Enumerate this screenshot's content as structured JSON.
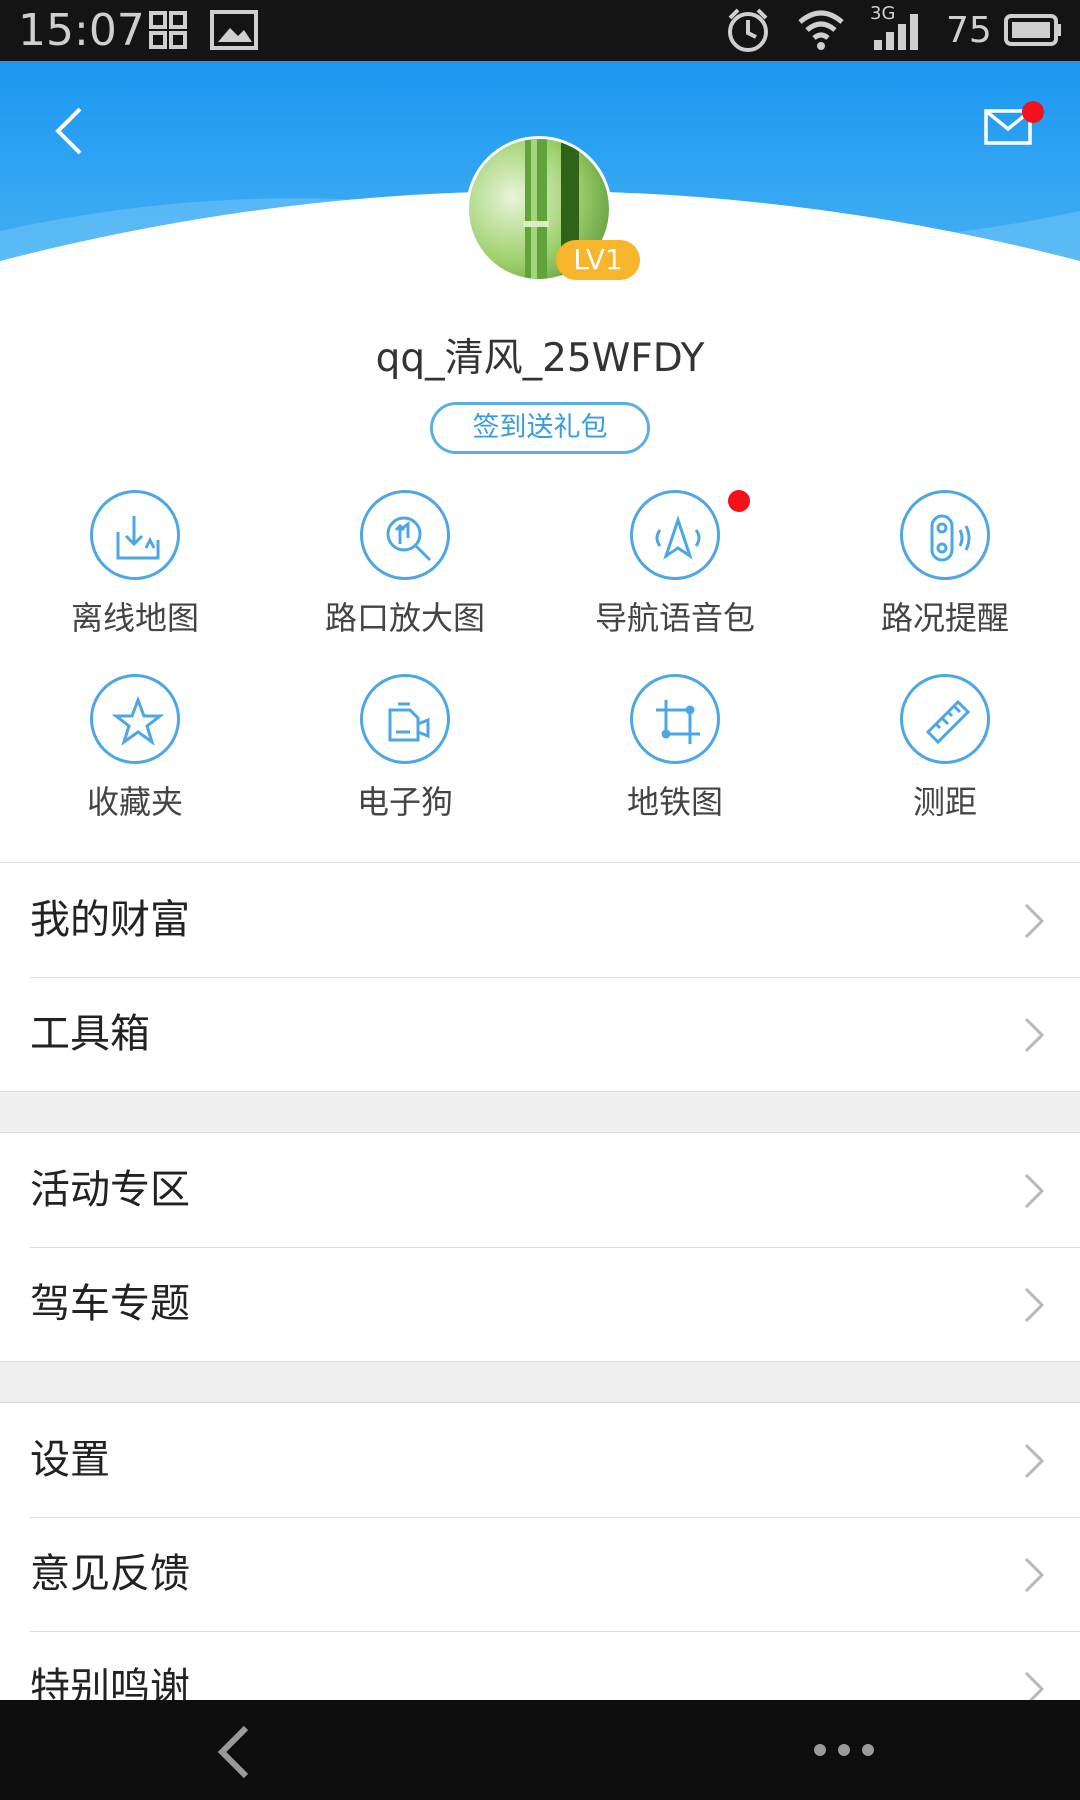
{
  "status_bar": {
    "time": "15:07",
    "network": "3G",
    "battery": "75"
  },
  "header": {
    "back_icon": "chevron-left-icon",
    "mail_icon": "mail-icon",
    "colors": {
      "header_top": "#1a97f0",
      "header_bottom": "#4fb6f5",
      "notification": "#f5101a"
    }
  },
  "profile": {
    "level": "LV1",
    "username": "qq_清风_25WFDY",
    "signin_label": "签到送礼包"
  },
  "grid": [
    {
      "label": "离线地图",
      "icon": "offline-map-download-icon"
    },
    {
      "label": "路口放大图",
      "icon": "junction-zoom-icon"
    },
    {
      "label": "导航语音包",
      "icon": "voice-navigation-icon"
    },
    {
      "label": "路况提醒",
      "icon": "traffic-alert-icon"
    },
    {
      "label": "收藏夹",
      "icon": "star-icon"
    },
    {
      "label": "电子狗",
      "icon": "speed-camera-icon"
    },
    {
      "label": "地铁图",
      "icon": "subway-map-icon"
    },
    {
      "label": "测距",
      "icon": "ruler-icon"
    }
  ],
  "list_groups": [
    {
      "items": [
        "我的财富",
        "工具箱"
      ]
    },
    {
      "items": [
        "活动专区",
        "驾车专题"
      ]
    },
    {
      "items": [
        "设置",
        "意见反馈",
        "特别鸣谢"
      ]
    }
  ],
  "nav_bar": {
    "back_icon": "back-arrow-icon",
    "more_icon": "more-dots-icon"
  }
}
